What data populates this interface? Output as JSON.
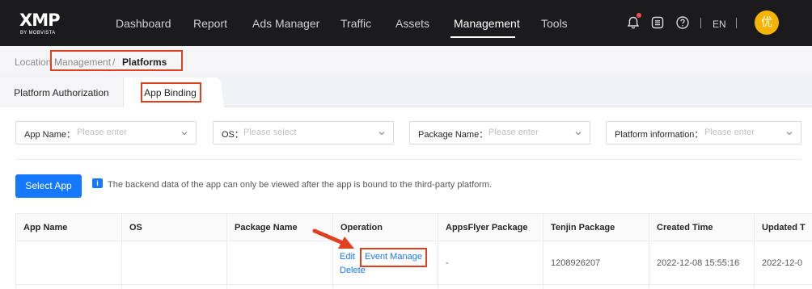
{
  "brand": {
    "logo_text": "XMP",
    "logo_sub": "BY MOBVISTA"
  },
  "nav": {
    "items": [
      "Dashboard",
      "Report",
      "Ads Manager",
      "Traffic",
      "Assets",
      "Management",
      "Tools"
    ],
    "active": "Management"
  },
  "header": {
    "icons": [
      "bell-icon",
      "document-list-icon",
      "help-icon"
    ],
    "language": "EN",
    "avatar_text": "优"
  },
  "breadcrumb": {
    "parent_a": "Location",
    "parent_b": "Management",
    "separator": "/",
    "current": "Platforms"
  },
  "tabs": {
    "items": [
      "Platform Authorization",
      "App Binding"
    ],
    "active": "App Binding"
  },
  "filters": [
    {
      "label": "App Name：",
      "placeholder": "Please enter"
    },
    {
      "label": "OS：",
      "placeholder": "Please select"
    },
    {
      "label": "Package Name：",
      "placeholder": "Please enter"
    },
    {
      "label": "Platform information：",
      "placeholder": "Please enter"
    }
  ],
  "actions": {
    "select_app": "Select App"
  },
  "notice": {
    "icon": "info-icon",
    "text": "The backend data of the app can only be viewed after the app is bound to the third-party platform."
  },
  "table": {
    "columns": [
      "App Name",
      "OS",
      "Package Name",
      "Operation",
      "AppsFlyer Package",
      "Tenjin Package",
      "Created Time",
      "Updated T"
    ],
    "rows": [
      {
        "app_name": "",
        "os": "",
        "package_name": "",
        "operations": [
          "Edit",
          "Event Manage",
          "Delete"
        ],
        "appsflyer_package": "-",
        "tenjin_package": "1208926207",
        "created_time": "2022-12-08 15:55:16",
        "updated_time": "2022-12-0"
      }
    ]
  },
  "colors": {
    "nav_bg": "#1b1b1d",
    "accent": "#1677ff",
    "highlight": "#e0401f",
    "avatar": "#f4b400"
  }
}
